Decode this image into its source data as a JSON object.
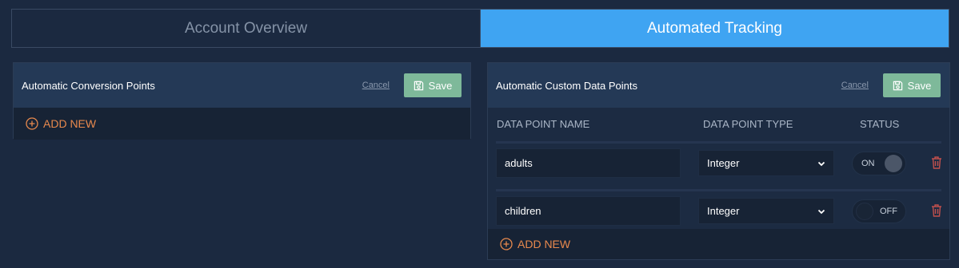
{
  "tabs": [
    {
      "label": "Account Overview",
      "active": false
    },
    {
      "label": "Automated Tracking",
      "active": true
    }
  ],
  "left_panel": {
    "title": "Automatic Conversion Points",
    "cancel_label": "Cancel",
    "save_label": "Save",
    "add_new_label": "ADD NEW"
  },
  "right_panel": {
    "title": "Automatic Custom Data Points",
    "cancel_label": "Cancel",
    "save_label": "Save",
    "columns": {
      "name": "DATA POINT NAME",
      "type": "DATA POINT TYPE",
      "status": "STATUS"
    },
    "rows": [
      {
        "name": "adults",
        "type": "Integer",
        "status": "ON"
      },
      {
        "name": "children",
        "type": "Integer",
        "status": "OFF"
      }
    ],
    "add_new_label": "ADD NEW"
  },
  "icons": {
    "save": "floppy-disk-icon",
    "add": "plus-circle-icon",
    "delete": "trash-icon",
    "select": "chevron-down-icon"
  },
  "colors": {
    "background": "#1b2940",
    "active_tab": "#3fa4f2",
    "save_button": "#7eb99a",
    "add_new": "#e8894d",
    "delete": "#c0504d"
  }
}
